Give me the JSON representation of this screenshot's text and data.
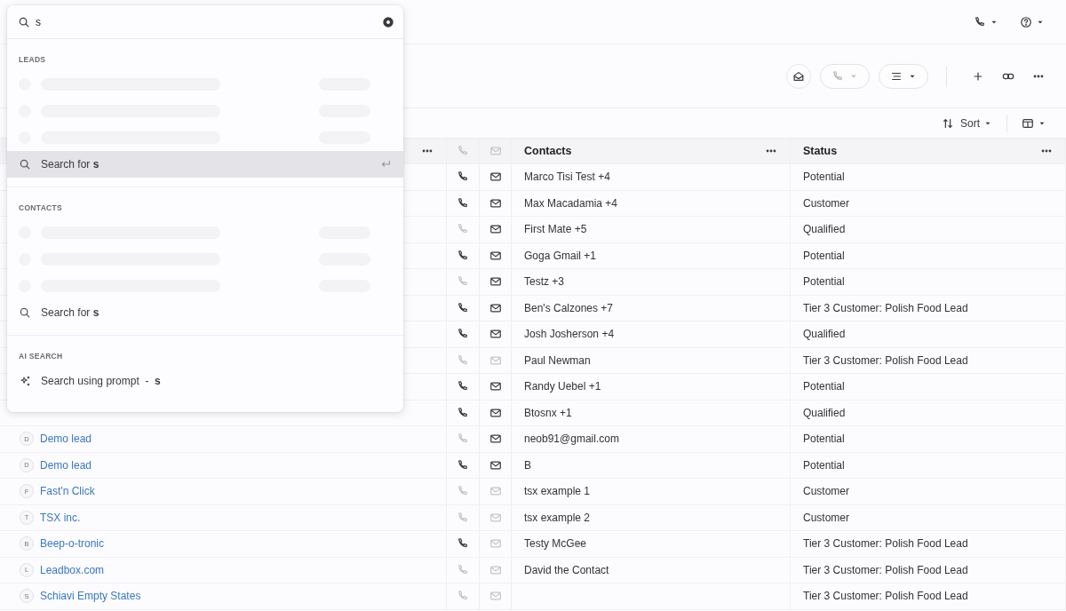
{
  "top_bar": {
    "buttons": [
      {
        "kind": "phone"
      },
      {
        "kind": "help"
      }
    ]
  },
  "record_actions": [
    {
      "kind": "email"
    },
    {
      "kind": "phone"
    },
    {
      "kind": "list"
    },
    {
      "kind": "add"
    },
    {
      "kind": "link"
    },
    {
      "kind": "more"
    }
  ],
  "toolbar": [
    {
      "kind": "sort",
      "label": "Sort"
    },
    {
      "kind": "columns"
    }
  ],
  "table": {
    "columns": [
      {
        "kind": "name"
      },
      {
        "kind": "phone"
      },
      {
        "kind": "email"
      },
      {
        "kind": "text",
        "label": "Contacts"
      },
      {
        "kind": "text",
        "label": "Status"
      }
    ],
    "rows": [
      {
        "phone": true,
        "email": true,
        "contacts": "Marco Tisi Test +4",
        "status": "Potential"
      },
      {
        "phone": true,
        "email": true,
        "contacts": "Max Macadamia +4",
        "status": "Customer"
      },
      {
        "phone": false,
        "email": true,
        "contacts": "First Mate +5",
        "status": "Qualified"
      },
      {
        "phone": true,
        "email": true,
        "contacts": "Goga Gmail +1",
        "status": "Potential"
      },
      {
        "phone": false,
        "email": true,
        "contacts": "Testz +3",
        "status": "Potential"
      },
      {
        "phone": true,
        "email": true,
        "contacts": "Ben's Calzones +7",
        "status": "Tier 3 Customer: Polish Food Lead"
      },
      {
        "phone": true,
        "email": true,
        "contacts": "Josh Josherson +4",
        "status": "Qualified"
      },
      {
        "phone": false,
        "email": false,
        "contacts": "Paul Newman",
        "status": "Tier 3 Customer: Polish Food Lead"
      },
      {
        "phone": true,
        "email": true,
        "contacts": "Randy Uebel +1",
        "status": "Potential"
      },
      {
        "phone": true,
        "email": true,
        "contacts": "Btosnx +1",
        "status": "Qualified"
      },
      {
        "lead": {
          "initial": "D",
          "name": "Demo lead"
        },
        "phone": false,
        "email": true,
        "contacts": "neob91@gmail.com",
        "status": "Potential"
      },
      {
        "lead": {
          "initial": "D",
          "name": "Demo lead"
        },
        "phone": true,
        "email": true,
        "contacts": "B",
        "status": "Potential"
      },
      {
        "lead": {
          "initial": "F",
          "name": "Fast'n Click"
        },
        "phone": false,
        "email": false,
        "contacts": "tsx example 1",
        "status": "Customer"
      },
      {
        "lead": {
          "initial": "T",
          "name": "TSX inc."
        },
        "phone": false,
        "email": false,
        "contacts": "tsx example 2",
        "status": "Customer"
      },
      {
        "lead": {
          "initial": "B",
          "name": "Beep-o-tronic"
        },
        "phone": true,
        "email": false,
        "contacts": "Testy McGee",
        "status": "Tier 3 Customer: Polish Food Lead"
      },
      {
        "lead": {
          "initial": "L",
          "name": "Leadbox.com"
        },
        "phone": false,
        "email": false,
        "contacts": "David the Contact",
        "status": "Tier 3 Customer: Polish Food Lead"
      },
      {
        "lead": {
          "initial": "S",
          "name": "Schiavi Empty States"
        },
        "phone": false,
        "email": false,
        "status": "Tier 3 Customer: Polish Food Lead"
      }
    ]
  },
  "search_dropdown": {
    "query": "s",
    "sections": [
      {
        "title": "LEADS",
        "loading_rows": [
          {
            "kind": "skeleton"
          },
          {
            "kind": "skeleton"
          },
          {
            "kind": "skeleton"
          }
        ],
        "option": {
          "kind": "search",
          "text": "Search for **s**",
          "selected": true
        }
      },
      {
        "title": "CONTACTS",
        "loading_rows": [
          {
            "kind": "skeleton"
          },
          {
            "kind": "skeleton"
          },
          {
            "kind": "skeleton"
          }
        ],
        "option": {
          "kind": "search",
          "text": "Search for **s**",
          "selected": false
        }
      },
      {
        "title": "AI SEARCH",
        "option": {
          "kind": "prompt",
          "text": "Search using prompt  -  **s**",
          "selected": false
        }
      }
    ]
  }
}
